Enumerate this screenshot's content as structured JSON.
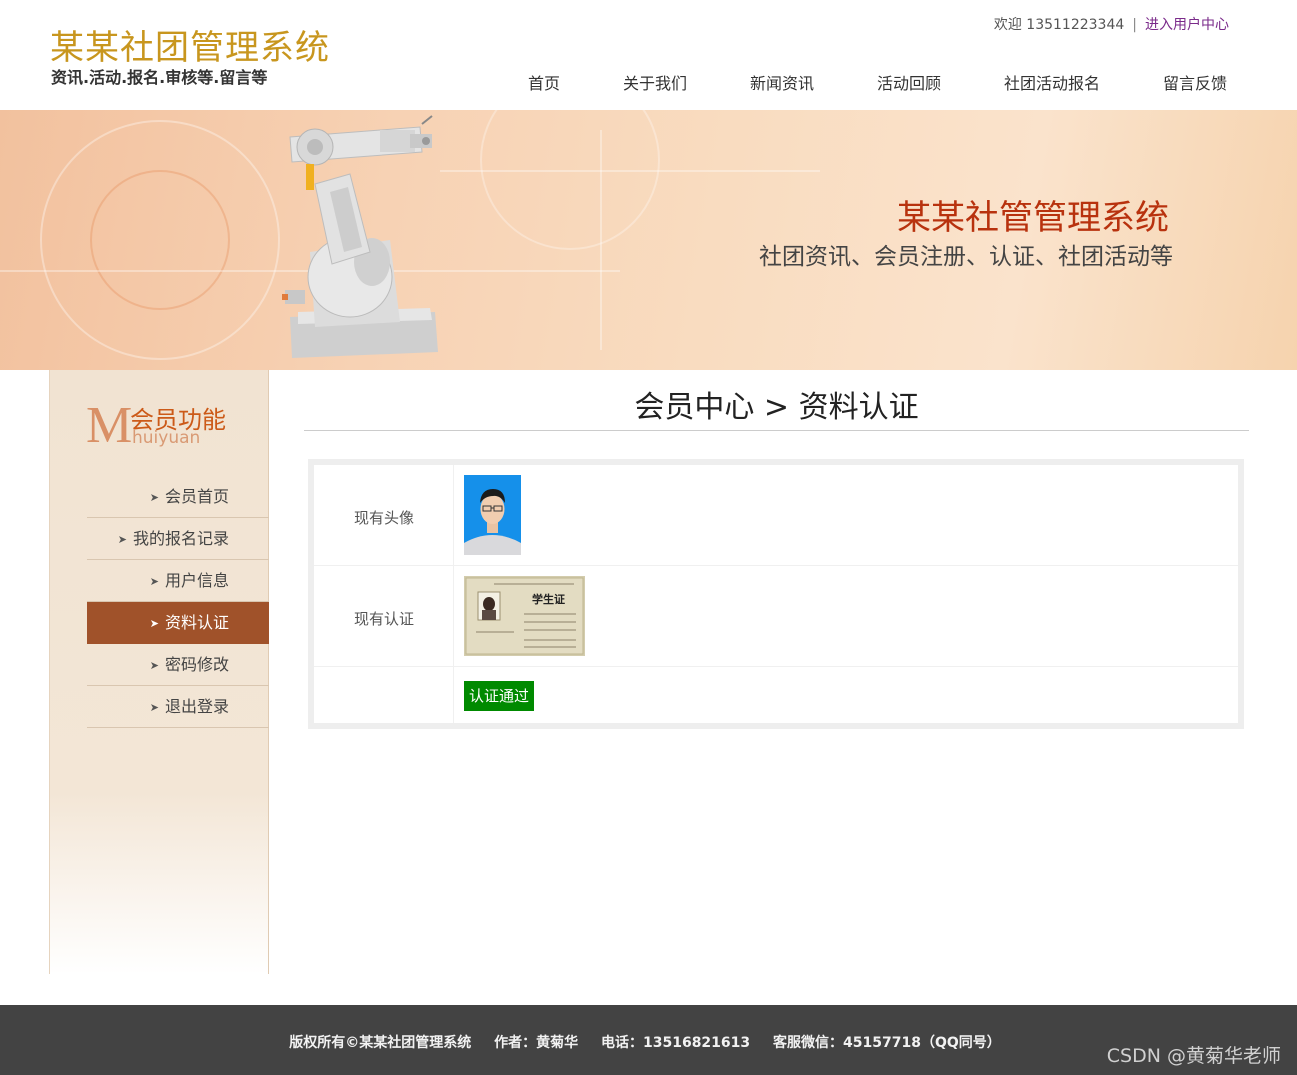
{
  "header": {
    "logo_title": "某某社团管理系统",
    "logo_subtitle": "资讯.活动.报名.审核等.留言等",
    "welcome_text": "欢迎 13511223344",
    "separator": "|",
    "user_center_link": "进入用户中心",
    "nav": [
      "首页",
      "关于我们",
      "新闻资讯",
      "活动回顾",
      "社团活动报名",
      "留言反馈"
    ]
  },
  "banner": {
    "title": "某某社管管理系统",
    "subtitle": "社团资讯、会员注册、认证、社团活动等"
  },
  "sidebar": {
    "head_letter": "M",
    "head_title": "会员功能",
    "head_pinyin": "huiyuan",
    "items": [
      {
        "label": "会员首页",
        "active": false
      },
      {
        "label": "我的报名记录",
        "active": false
      },
      {
        "label": "用户信息",
        "active": false
      },
      {
        "label": "资料认证",
        "active": true
      },
      {
        "label": "密码修改",
        "active": false
      },
      {
        "label": "退出登录",
        "active": false
      }
    ]
  },
  "main": {
    "page_title": "会员中心 > 资料认证",
    "rows": [
      {
        "label": "现有头像"
      },
      {
        "label": "现有认证"
      },
      {
        "label": ""
      }
    ],
    "status_badge": "认证通过"
  },
  "footer": {
    "copyright": "版权所有©某某社团管理系统",
    "author": "作者：黄菊华",
    "phone": "电话：13516821613",
    "wechat": "客服微信：45157718（QQ同号）",
    "watermark": "CSDN @黄菊华老师"
  },
  "colors": {
    "logo": "#c8961e",
    "banner_title": "#b8320e",
    "sidebar_active": "#a0522a",
    "badge_bg": "#008a00",
    "footer_bg": "#434343"
  }
}
